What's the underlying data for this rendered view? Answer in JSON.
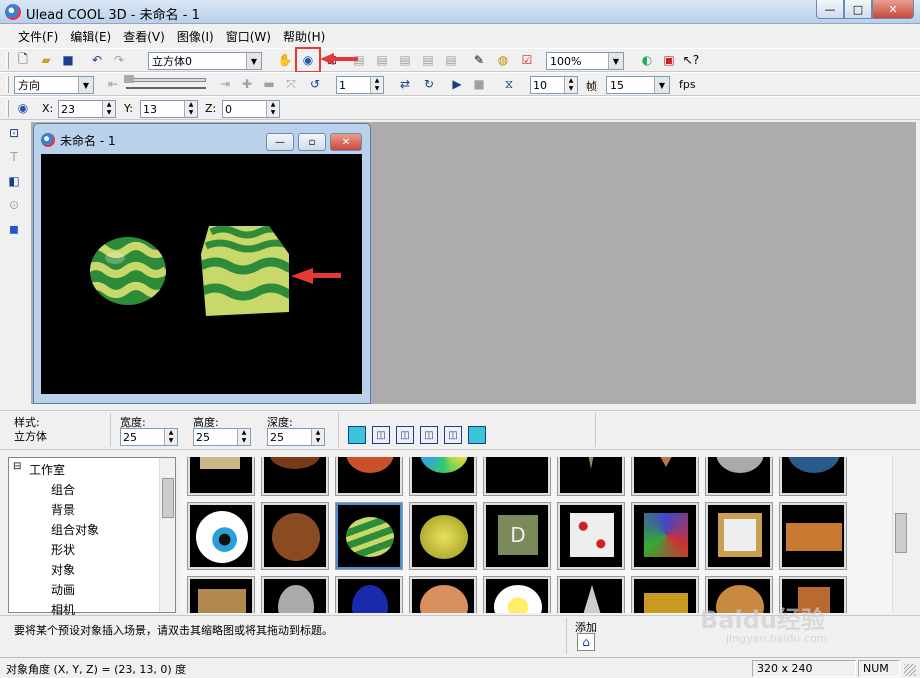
{
  "window": {
    "title": "Ulead COOL 3D - 未命名 - 1",
    "min": "—",
    "max": "□",
    "close": "✕"
  },
  "menu": [
    "文件(F)",
    "编辑(E)",
    "查看(V)",
    "图像(I)",
    "窗口(W)",
    "帮助(H)"
  ],
  "toolbar1": {
    "object_combo": "立方体0",
    "zoom_combo": "100%"
  },
  "toolbar2": {
    "mode_combo": "方向",
    "frame_value": "1",
    "speed_value": "10",
    "frame_label": "帧",
    "fps_value": "15",
    "fps_label": "fps"
  },
  "toolbar3": {
    "x_label": "X:",
    "x_value": "23",
    "y_label": "Y:",
    "y_value": "13",
    "z_label": "Z:",
    "z_value": "0"
  },
  "document": {
    "title": "未命名 - 1"
  },
  "properties": {
    "style_label": "样式:",
    "style_value": "立方体",
    "width_label": "宽度:",
    "width_value": "25",
    "height_label": "高度:",
    "height_value": "25",
    "depth_label": "深度:",
    "depth_value": "25"
  },
  "tree": {
    "root": "工作室",
    "items": [
      "组合",
      "背景",
      "组合对象",
      "形状",
      "对象",
      "动画",
      "相机"
    ]
  },
  "hint": {
    "text": "要将某个预设对象插入场景，请双击其缩略图或将其拖动到标题。",
    "add_label": "添加"
  },
  "status": {
    "left": "对象角度 (X, Y, Z) = (23, 13, 0) 度",
    "size": "320 x 240",
    "num": "NUM"
  },
  "watermark": {
    "brand": "Baidu经验",
    "url": "jingyan.baidu.com"
  },
  "colors": {
    "annotation_red": "#e53935",
    "canvas_bg": "#000000",
    "stripe_green": "#2e8b3a",
    "stripe_yellow": "#c8d86a"
  }
}
